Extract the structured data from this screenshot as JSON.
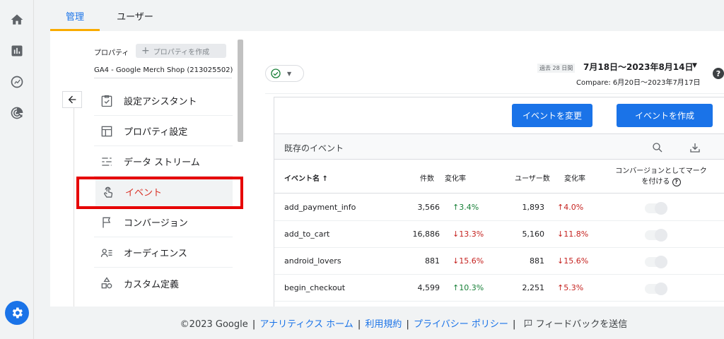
{
  "tabs": [
    {
      "label": "管理",
      "active": true
    },
    {
      "label": "ユーザー",
      "active": false
    }
  ],
  "rail": {
    "icons": [
      "home-icon",
      "reports-icon",
      "explore-icon",
      "advertising-icon"
    ],
    "settings_icon": "settings-icon"
  },
  "adminnav": {
    "property_label": "プロパティ",
    "create_property_label": "プロパティを作成",
    "property_name": "GA4 - Google Merch Shop (213025502)",
    "items": [
      {
        "label": "設定アシスタント",
        "icon": "checklist-icon"
      },
      {
        "label": "プロパティ設定",
        "icon": "layout-icon"
      },
      {
        "label": "データ ストリーム",
        "icon": "streams-icon"
      },
      {
        "label": "イベント",
        "icon": "touch-icon",
        "active": true
      },
      {
        "label": "コンバージョン",
        "icon": "flag-icon"
      },
      {
        "label": "オーディエンス",
        "icon": "audience-icon"
      },
      {
        "label": "カスタム定義",
        "icon": "shapes-icon"
      }
    ]
  },
  "date": {
    "badge": "過去 28 日間",
    "range": "7月18日～2023年8月14日",
    "compare": "Compare: 6月20日～2023年7月17日"
  },
  "buttons": {
    "modify_event": "イベントを変更",
    "create_event": "イベントを作成"
  },
  "table": {
    "section_title": "既存のイベント",
    "headers": {
      "event_name": "イベント名 ↑",
      "count": "件数",
      "count_change": "変化率",
      "users": "ユーザー数",
      "users_change": "変化率",
      "mark_conversion_line1": "コンバージョンとしてマーク",
      "mark_conversion_line2": "を付ける"
    },
    "rows": [
      {
        "name": "add_payment_info",
        "count": "3,566",
        "count_change": "3.4%",
        "count_dir": "up",
        "users": "1,893",
        "users_change": "4.0%",
        "users_dir": "up-red",
        "conversion": false
      },
      {
        "name": "add_to_cart",
        "count": "16,886",
        "count_change": "13.3%",
        "count_dir": "down",
        "users": "5,160",
        "users_change": "11.8%",
        "users_dir": "down",
        "conversion": false
      },
      {
        "name": "android_lovers",
        "count": "881",
        "count_change": "15.6%",
        "count_dir": "down",
        "users": "881",
        "users_change": "15.6%",
        "users_dir": "down",
        "conversion": false
      },
      {
        "name": "begin_checkout",
        "count": "4,599",
        "count_change": "10.3%",
        "count_dir": "up",
        "users": "2,251",
        "users_change": "5.3%",
        "users_dir": "up-red",
        "conversion": false
      }
    ]
  },
  "footer": {
    "copyright": "©2023 Google",
    "links": [
      "アナリティクス ホーム",
      "利用規約",
      "プライバシー ポリシー"
    ],
    "feedback": "フィードバックを送信"
  },
  "colors": {
    "accent": "#1a73e8",
    "tab_underline": "#f9ab00",
    "highlight_box": "#e60000",
    "positive": "#188038",
    "negative": "#c5221f"
  }
}
